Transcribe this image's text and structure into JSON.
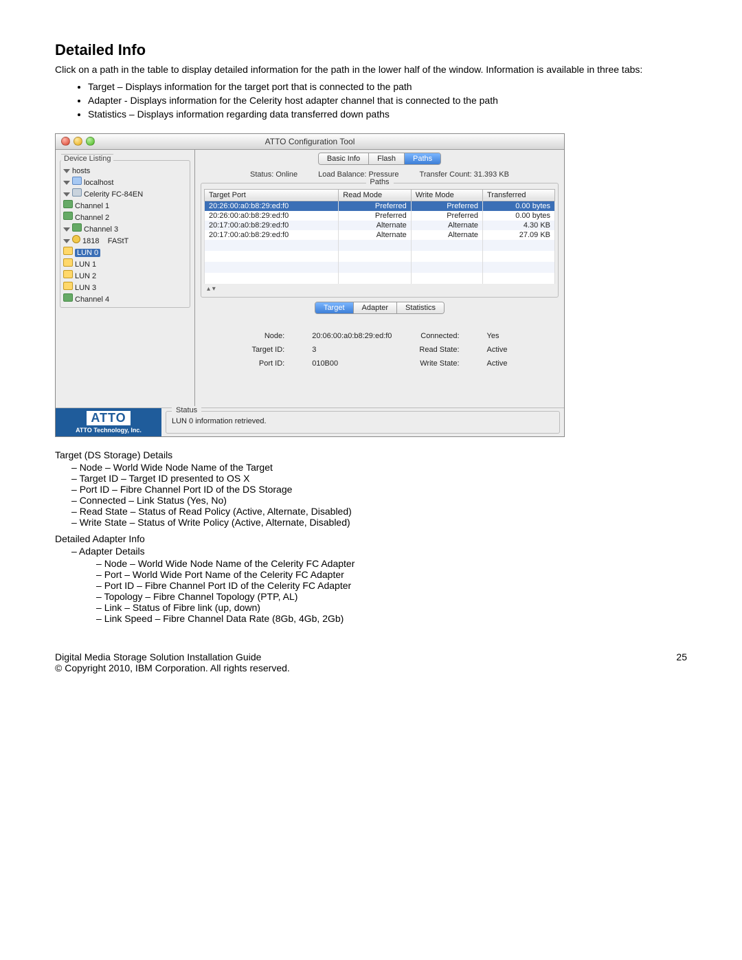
{
  "heading": "Detailed Info",
  "intro": "Click on a path in the table to display detailed information for the path in the lower half of the window.  Information is available in three tabs:",
  "intro_bullets": [
    "Target – Displays information for the target port that is connected to the path",
    "Adapter - Displays information for the Celerity host adapter channel that is connected to the path",
    "Statistics – Displays information regarding data transferred down paths"
  ],
  "window": {
    "title": "ATTO Configuration Tool",
    "device_listing_label": "Device Listing",
    "tree": {
      "hosts": "hosts",
      "localhost": "localhost",
      "adapter": "Celerity FC-84EN",
      "channels": [
        "Channel 1",
        "Channel 2",
        "Channel 3",
        "Channel 4"
      ],
      "ch3": {
        "id": "1818",
        "type": "FAStT",
        "luns": [
          "LUN 0",
          "LUN 1",
          "LUN 2",
          "LUN 3"
        ]
      }
    },
    "top_tabs": [
      "Basic Info",
      "Flash",
      "Paths"
    ],
    "top_tab_active": 2,
    "status_line": {
      "status": "Status:  Online",
      "lb": "Load Balance:  Pressure",
      "tc": "Transfer Count:  31.393 KB"
    },
    "table": {
      "headers": [
        "Target Port",
        "Read Mode",
        "Write Mode",
        "Transferred"
      ],
      "rows": [
        {
          "port": "20:26:00:a0:b8:29:ed:f0",
          "read": "Preferred",
          "write": "Preferred",
          "xfer": "0.00 bytes",
          "sel": true
        },
        {
          "port": "20:26:00:a0:b8:29:ed:f0",
          "read": "Preferred",
          "write": "Preferred",
          "xfer": "0.00 bytes"
        },
        {
          "port": "20:17:00:a0:b8:29:ed:f0",
          "read": "Alternate",
          "write": "Alternate",
          "xfer": "4.30 KB"
        },
        {
          "port": "20:17:00:a0:b8:29:ed:f0",
          "read": "Alternate",
          "write": "Alternate",
          "xfer": "27.09 KB"
        }
      ]
    },
    "detail_tabs": [
      "Target",
      "Adapter",
      "Statistics"
    ],
    "detail_tab_active": 0,
    "target_details": {
      "node_l": "Node:",
      "node_v": "20:06:00:a0:b8:29:ed:f0",
      "conn_l": "Connected:",
      "conn_v": "Yes",
      "tid_l": "Target ID:",
      "tid_v": "3",
      "rs_l": "Read State:",
      "rs_v": "Active",
      "pid_l": "Port ID:",
      "pid_v": "010B00",
      "ws_l": "Write State:",
      "ws_v": "Active"
    },
    "brand": {
      "logo": "ATTO",
      "company": "ATTO Technology, Inc."
    },
    "status_msg": "LUN 0 information retrieved."
  },
  "after": {
    "t_head": "Target (DS Storage) Details",
    "t_items": [
      "Node – World Wide Node Name of the Target",
      "Target ID – Target ID presented to OS X",
      "Port ID – Fibre Channel Port ID of the DS Storage",
      "Connected – Link Status (Yes, No)",
      "Read State – Status of Read Policy (Active, Alternate, Disabled)",
      "Write State – Status of Write Policy (Active, Alternate, Disabled)"
    ],
    "a_head": "Detailed Adapter Info",
    "a_sub": "Adapter Details",
    "a_items": [
      "Node – World Wide Node Name of the Celerity FC Adapter",
      "Port – World Wide Port Name of the Celerity FC Adapter",
      "Port ID – Fibre Channel Port ID of the Celerity FC Adapter",
      "Topology – Fibre Channel Topology (PTP, AL)",
      "Link – Status of Fibre link (up, down)",
      "Link Speed – Fibre Channel Data Rate (8Gb, 4Gb, 2Gb)"
    ]
  },
  "footer": {
    "l1": "Digital Media Storage Solution Installation Guide",
    "l2": "© Copyright 2010, IBM Corporation. All rights reserved.",
    "page": "25"
  }
}
